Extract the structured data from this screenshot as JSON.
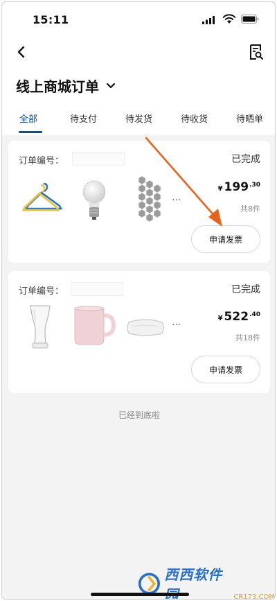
{
  "status_bar": {
    "time": "15:11"
  },
  "header": {
    "title": "线上商城订单"
  },
  "tabs": [
    {
      "label": "全部",
      "active": true
    },
    {
      "label": "待支付",
      "active": false
    },
    {
      "label": "待发货",
      "active": false
    },
    {
      "label": "待收货",
      "active": false
    },
    {
      "label": "待晒单",
      "active": false
    }
  ],
  "orders": [
    {
      "order_no_label": "订单编号：",
      "status": "已完成",
      "items_icons": [
        "clothes-hanger-icon",
        "light-bulb-icon",
        "hexagon-panel-icon"
      ],
      "more": "...",
      "price_currency": "¥",
      "price_int": "199",
      "price_dec": ".30",
      "count": "共8件",
      "invoice_button": "申请发票"
    },
    {
      "order_no_label": "订单编号：",
      "status": "已完成",
      "items_icons": [
        "beer-glass-icon",
        "mug-icon",
        "pillow-icon"
      ],
      "more": "...",
      "price_currency": "¥",
      "price_int": "522",
      "price_dec": ".40",
      "count": "共18件",
      "invoice_button": "申请发票"
    }
  ],
  "end_text": "已经到底啦",
  "watermark": {
    "brand": "西西软件园",
    "site": "CR173.COM"
  },
  "colors": {
    "accent": "#0a4f8a",
    "arrow": "#e8621a",
    "background": "#f3f3f3"
  }
}
